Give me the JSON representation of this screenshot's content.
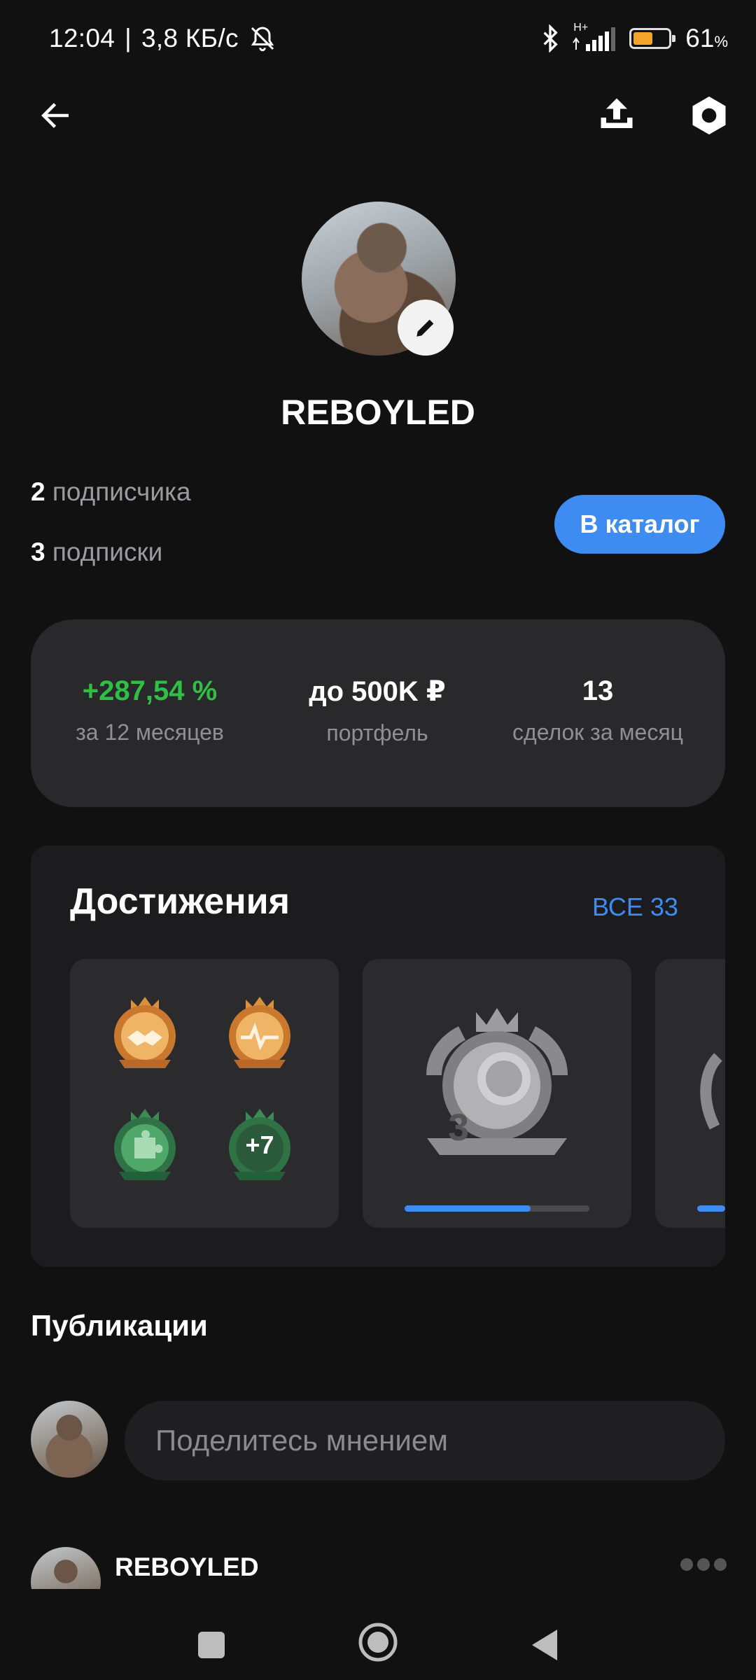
{
  "status_bar": {
    "time": "12:04",
    "separator": "|",
    "speed": "3,8 КБ/с",
    "network": "H+",
    "battery_percent": "61",
    "battery_unit": "%",
    "battery_level": 0.61
  },
  "profile": {
    "username": "REBOYLED",
    "followers_count": "2",
    "followers_label": "подписчика",
    "following_count": "3",
    "following_label": "подписки",
    "catalog_button": "В каталог"
  },
  "stats": [
    {
      "value": "+287,54 %",
      "label": "за 12 месяцев",
      "color": "#2fbf45"
    },
    {
      "value": "до 500K ₽",
      "label": "портфель",
      "color": "#ffffff"
    },
    {
      "value": "13",
      "label": "сделок за месяц",
      "color": "#ffffff"
    }
  ],
  "achievements": {
    "title": "Достижения",
    "all_link": "ВСЕ 33",
    "more_badge": "+7",
    "level_number": "3",
    "progress": 0.68
  },
  "publications": {
    "title": "Публикации",
    "input_placeholder": "Поделитесь мнением",
    "post_author": "REBOYLED"
  },
  "colors": {
    "accent": "#3e8cf2",
    "positive": "#2fbf45",
    "background": "#111112",
    "card": "#29292b"
  }
}
